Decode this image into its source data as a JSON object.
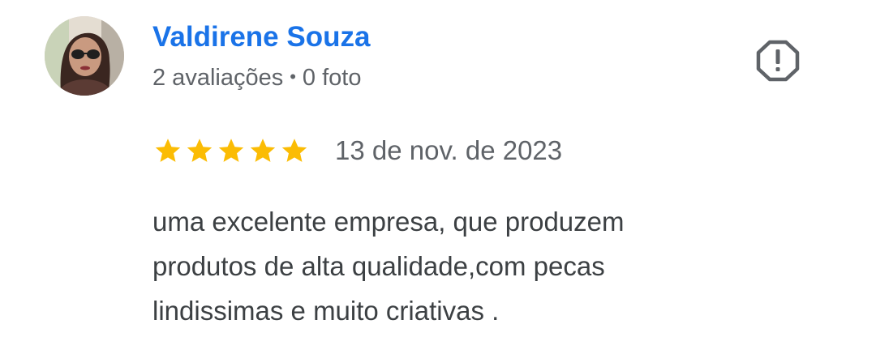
{
  "review": {
    "author": {
      "name": "Valdirene Souza",
      "reviews_count": "2 avaliações",
      "separator": "•",
      "photos_count": "0 foto"
    },
    "rating": {
      "stars": 5,
      "max": 5,
      "star_color": "#fbbc04"
    },
    "date": "13 de nov. de 2023",
    "text_lines": [
      "uma excelente empresa, que produzem",
      "produtos de alta qualidade,com pecas",
      "lindissimas e muito criativas ."
    ],
    "icons": {
      "report": "report-octagon-icon",
      "star": "star-icon"
    },
    "colors": {
      "name": "#1a73e8",
      "meta": "#5f6368",
      "body_text": "#3c4043",
      "report_icon": "#5f6368"
    }
  }
}
